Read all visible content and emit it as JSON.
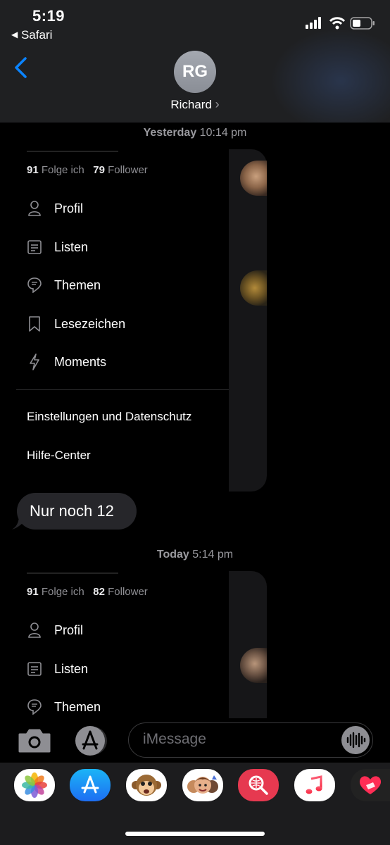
{
  "status": {
    "time": "5:19",
    "back_app": "Safari"
  },
  "header": {
    "initials": "RG",
    "contact_name": "Richard",
    "contact_chevron": "›"
  },
  "timestamps": [
    {
      "day": "Yesterday",
      "time": "10:14 pm"
    },
    {
      "day": "Today",
      "time": "5:14 pm"
    }
  ],
  "shot1": {
    "following_count": "91",
    "following_label": "Folge ich",
    "followers_count": "79",
    "followers_label": "Follower",
    "menu": [
      "Profil",
      "Listen",
      "Themen",
      "Lesezeichen",
      "Moments"
    ],
    "settings": "Einstellungen und Datenschutz",
    "help": "Hilfe-Center"
  },
  "message": {
    "text": "Nur noch 12"
  },
  "shot2": {
    "following_count": "91",
    "following_label": "Folge ich",
    "followers_count": "82",
    "followers_label": "Follower",
    "menu": [
      "Profil",
      "Listen",
      "Themen"
    ]
  },
  "composer": {
    "placeholder": "iMessage"
  },
  "apps": [
    "photos-icon",
    "app-store-icon",
    "animoji-icon",
    "memoji-icon",
    "web-images-icon",
    "music-icon",
    "heart-icon"
  ],
  "colors": {
    "accent": "#0a84ff",
    "bubble": "#26262a",
    "header": "#1f2022"
  }
}
